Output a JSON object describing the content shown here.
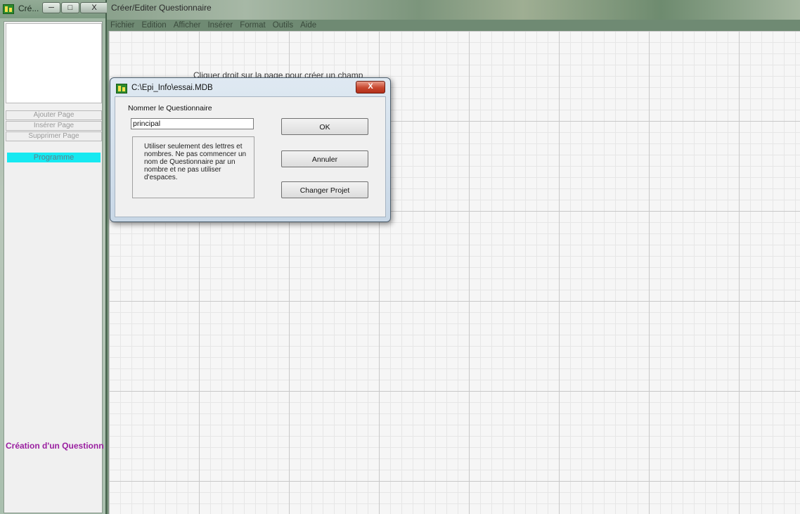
{
  "left_window": {
    "title": "Cré...",
    "buttons": {
      "minimize": "─",
      "maximize": "□",
      "close": "X"
    },
    "page_buttons": {
      "add": "Ajouter Page",
      "insert": "Insérer Page",
      "delete": "Supprimer Page"
    },
    "program_button": "Programme",
    "status_label": "Création d'un Questionnaire"
  },
  "main_window": {
    "title": "Créer/Editer Questionnaire",
    "menu": [
      "Fichier",
      "Edition",
      "Afficher",
      "Insérer",
      "Format",
      "Outils",
      "Aide"
    ],
    "canvas_hint": "Cliquer droit sur la page pour créer un champ"
  },
  "dialog": {
    "title": "C:\\Epi_Info\\essai.MDB",
    "close_label": "X",
    "label": "Nommer le Questionnaire",
    "input_value": "principal",
    "info_text": "Utiliser seulement des lettres et nombres. Ne pas commencer un nom de Questionnaire par un nombre et ne pas utiliser d'espaces.",
    "buttons": {
      "ok": "OK",
      "cancel": "Annuler",
      "change_project": "Changer Projet"
    }
  },
  "colors": {
    "program_button_bg": "#16e9f1",
    "status_label": "#9a1fa0",
    "dialog_close": "#c8472f"
  }
}
